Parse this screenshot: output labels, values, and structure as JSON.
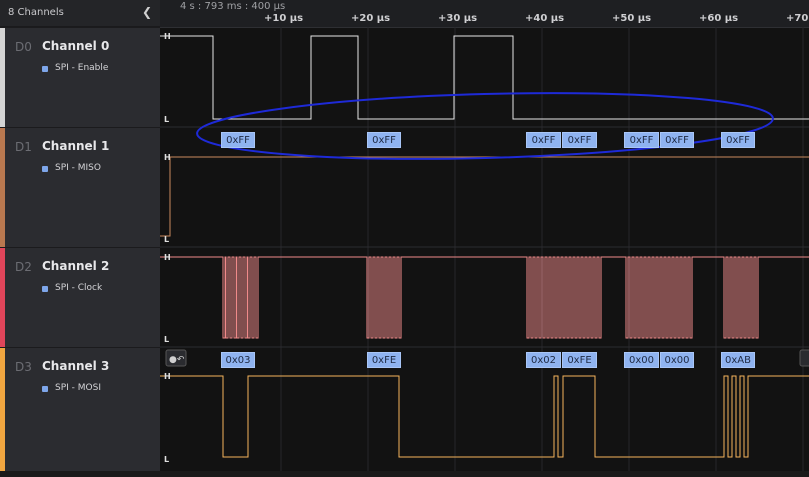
{
  "sidebar": {
    "title": "8 Channels",
    "collapse_icon": "chevron-left-icon",
    "channels": [
      {
        "id": "D0",
        "name": "Channel 0",
        "analyzer": "SPI - Enable",
        "color": "#d4d4d4"
      },
      {
        "id": "D1",
        "name": "Channel 1",
        "analyzer": "SPI - MISO",
        "color": "#b9784f"
      },
      {
        "id": "D2",
        "name": "Channel 2",
        "analyzer": "SPI - Clock",
        "color": "#e0455a"
      },
      {
        "id": "D3",
        "name": "Channel 3",
        "analyzer": "SPI - MOSI",
        "color": "#f0a640"
      }
    ]
  },
  "timeline": {
    "origin": "4 s : 793 ms : 400 µs",
    "ticks": [
      "+10 µs",
      "+20 µs",
      "+30 µs",
      "+40 µs",
      "+50 µs",
      "+60 µs",
      "+70"
    ]
  },
  "levels": {
    "high": "H",
    "low": "L"
  },
  "miso_bytes": [
    "0xFF",
    "0xFF",
    "0xFF",
    "0xFF",
    "0xFF",
    "0xFF",
    "0xFF"
  ],
  "mosi_bytes": [
    "0x03",
    "0xFE",
    "0x02",
    "0xFE",
    "0x00",
    "0x00",
    "0xAB"
  ],
  "colors": {
    "enable": "#e6e6e6",
    "miso": "#c98a5e",
    "clock": "#f08a8a",
    "mosi": "#f5b45c",
    "bubble": "#8fb3f0",
    "annotation": "#1e2ad8"
  }
}
